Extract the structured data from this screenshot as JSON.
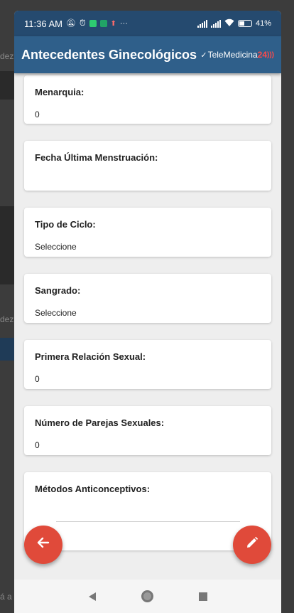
{
  "status_bar": {
    "time": "11:36 AM",
    "icons": [
      "mute-icon",
      "alarm-icon",
      "whatsapp-icon",
      "sheets-icon",
      "upload-icon",
      "more-icon"
    ],
    "more": "···",
    "battery": "41%"
  },
  "app_bar": {
    "title": "Antecedentes Ginecológicos",
    "brand_main": "TeleMedicina",
    "brand_accent": "24"
  },
  "background": {
    "text_1": "dez",
    "text_2": "dez",
    "text_3": "á a"
  },
  "fields": [
    {
      "label": "Menarquia:",
      "value": "0"
    },
    {
      "label": "Fecha Última Menstruación:",
      "value": ""
    },
    {
      "label": "Tipo de Ciclo:",
      "value": "Seleccione"
    },
    {
      "label": "Sangrado:",
      "value": "Seleccione"
    },
    {
      "label": "Primera Relación Sexual:",
      "value": "0"
    },
    {
      "label": "Número de Parejas Sexuales:",
      "value": "0"
    },
    {
      "label": "Métodos Anticonceptivos:",
      "value": ""
    }
  ],
  "colors": {
    "primary": "#2f5f8a",
    "status_bar": "#254a6f",
    "fab": "#e04a3a",
    "brand_accent": "#ff4a4a"
  },
  "fab_back_icon": "arrow-left-icon",
  "fab_edit_icon": "pencil-icon"
}
